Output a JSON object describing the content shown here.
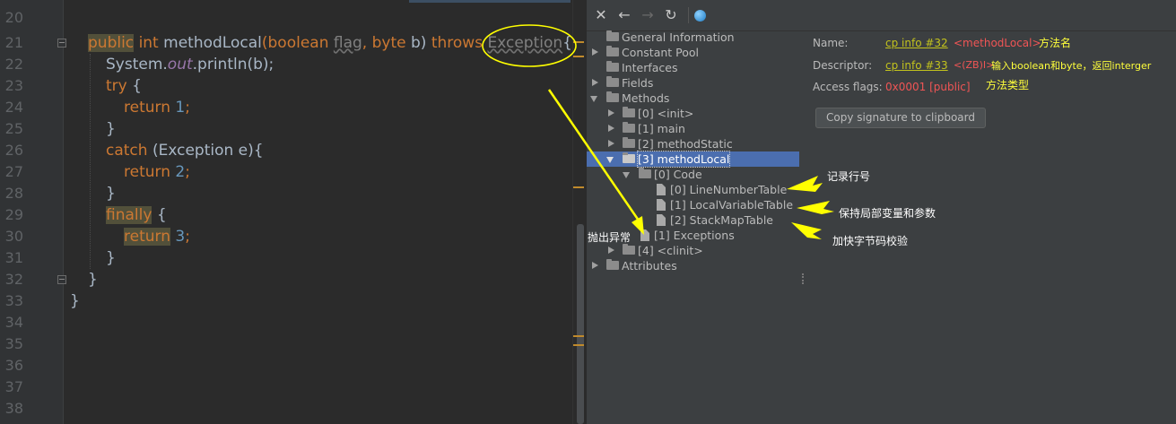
{
  "editor": {
    "line_numbers": [
      "20",
      "21",
      "22",
      "23",
      "24",
      "25",
      "26",
      "27",
      "28",
      "29",
      "30",
      "31",
      "32",
      "33",
      "34",
      "35",
      "36",
      "37",
      "38"
    ],
    "code": {
      "kw_public": "public",
      "kw_int": "int",
      "method_name": "methodLocal",
      "paren_open": "(",
      "kw_boolean": "boolean",
      "param_flag": "flag",
      "comma": ",",
      "kw_byte": "byte",
      "param_b": "b)",
      "kw_throws": "throws",
      "exception_type": "Exception",
      "brace_open": "{",
      "system": "System.",
      "out": "out",
      "println": ".println(b);",
      "kw_try": "try",
      "kw_return": "return",
      "num_1": "1",
      "num_2": "2",
      "num_3": "3",
      "semicolon": ";",
      "brace_close": "}",
      "kw_catch": "catch",
      "catch_arg": "(Exception e){",
      "kw_finally": "finally"
    }
  },
  "viewer": {
    "toolbar": {
      "close_icon": "✕",
      "back_icon": "←",
      "forward_icon": "→",
      "refresh_icon": "↻"
    },
    "tree": {
      "general_information": "General Information",
      "constant_pool": "Constant Pool",
      "interfaces": "Interfaces",
      "fields": "Fields",
      "methods": "Methods",
      "m0": "[0] <init>",
      "m1": "[1] main",
      "m2": "[2] methodStatic",
      "m3": "[3] methodLocal",
      "code": "[0] Code",
      "line_number_table": "[0] LineNumberTable",
      "local_variable_table": "[1] LocalVariableTable",
      "stack_map_table": "[2] StackMapTable",
      "exceptions": "[1] Exceptions",
      "m4": "[4] <clinit>",
      "attributes": "Attributes"
    },
    "details": {
      "name_label": "Name:",
      "name_link": "cp info #32",
      "name_value": "<methodLocal>",
      "descriptor_label": "Descriptor:",
      "descriptor_link": "cp info #33",
      "descriptor_value": "<(ZB)I>",
      "access_label": "Access flags:",
      "access_value": "0x0001 [public]",
      "copy_button": "Copy signature to clipboard"
    }
  },
  "annotations": {
    "method_name": "方法名",
    "descriptor_note": "输入boolean和byte，返回interger",
    "descriptor_note_2": "方法类型",
    "line_number": "记录行号",
    "local_vars": "保持局部变量和参数",
    "stack_map": "加快字节码校验",
    "exceptions": "抛出异常"
  },
  "colors": {
    "keyword": "#cc7832",
    "text": "#a9b7c6",
    "number": "#6897bb",
    "static_field": "#9876aa",
    "selection": "#4b6eaf",
    "annotation_arrow": "#ffff00"
  }
}
